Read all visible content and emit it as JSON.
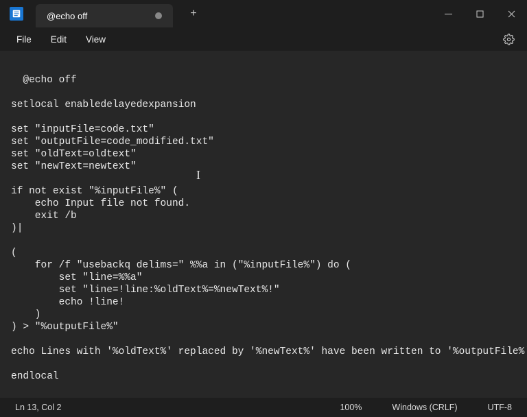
{
  "titlebar": {
    "tab_title": "@echo off",
    "new_tab_label": "+"
  },
  "menubar": {
    "file": "File",
    "edit": "Edit",
    "view": "View"
  },
  "editor": {
    "content": "@echo off\n\nsetlocal enabledelayedexpansion\n\nset \"inputFile=code.txt\"\nset \"outputFile=code_modified.txt\"\nset \"oldText=oldtext\"\nset \"newText=newtext\"\n\nif not exist \"%inputFile%\" (\n    echo Input file not found.\n    exit /b\n)|\n\n(\n    for /f \"usebackq delims=\" %%a in (\"%inputFile%\") do (\n        set \"line=%%a\"\n        set \"line=!line:%oldText%=%newText%!\"\n        echo !line!\n    )\n) > \"%outputFile%\"\n\necho Lines with '%oldText%' replaced by '%newText%' have been written to '%outputFile%'.\n\nendlocal"
  },
  "statusbar": {
    "position": "Ln 13, Col 2",
    "zoom": "100%",
    "line_ending": "Windows (CRLF)",
    "encoding": "UTF-8"
  }
}
